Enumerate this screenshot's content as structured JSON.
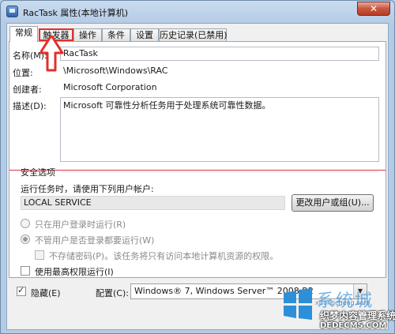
{
  "window": {
    "title": "RacTask 属性(本地计算机)",
    "close_label": "✕"
  },
  "tabs": [
    {
      "label": "常规"
    },
    {
      "label": "触发器"
    },
    {
      "label": "操作"
    },
    {
      "label": "条件"
    },
    {
      "label": "设置"
    },
    {
      "label": "历史记录(已禁用)"
    }
  ],
  "general": {
    "name_label": "名称(M):",
    "name_value": "RacTask",
    "location_label": "位置:",
    "location_value": "\\Microsoft\\Windows\\RAC",
    "author_label": "创建者:",
    "author_value": "Microsoft Corporation",
    "desc_label": "描述(D):",
    "desc_value": "Microsoft 可靠性分析任务用于处理系统可靠性数据。"
  },
  "security": {
    "group_label": "安全选项",
    "run_as_label": "运行任务时，请使用下列用户帐户:",
    "account": "LOCAL SERVICE",
    "change_button": "更改用户或组(U)...",
    "opt_logged_on": "只在用户登录时运行(R)",
    "opt_whether": "不管用户是否登录都要运行(W)",
    "opt_no_password": "不存储密码(P)。该任务将只有访问本地计算机资源的权限。",
    "opt_highest": "使用最高权限运行(I)"
  },
  "footer": {
    "hidden_label": "隐藏(E)",
    "config_label": "配置(C):",
    "config_value": "Windows® 7, Windows Server™ 2008 R2"
  },
  "watermark": {
    "brand_top": "系统城",
    "brand_sub": "xitongcheng.com",
    "site_name": "织梦内容管理系统",
    "site_url": "DEDECMS.COM"
  },
  "colors": {
    "annotation": "#e2302a",
    "selection": "#d7384d"
  }
}
